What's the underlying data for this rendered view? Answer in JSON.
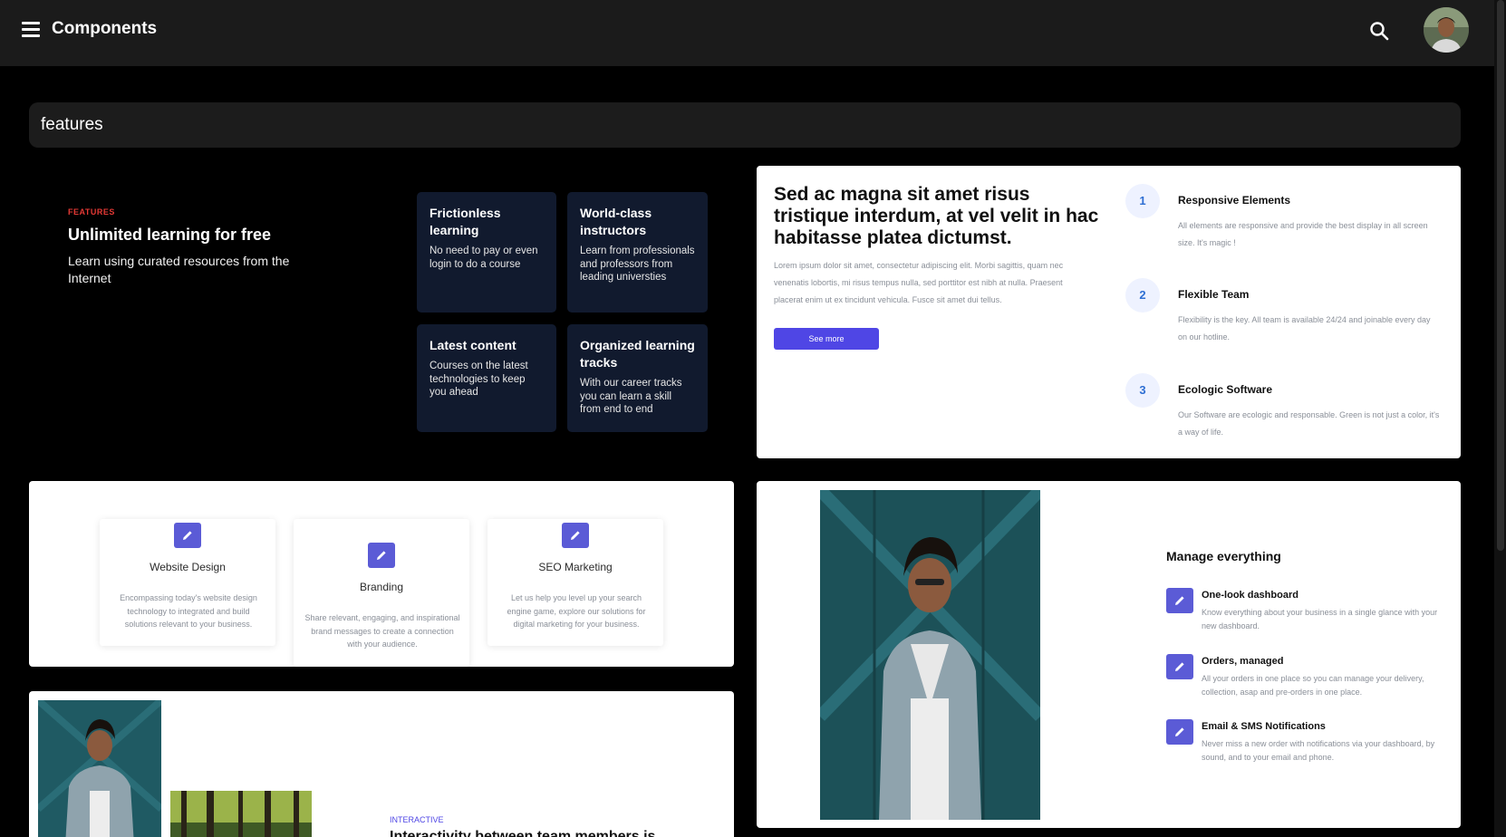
{
  "header": {
    "title": "Components"
  },
  "filter": {
    "value": "features"
  },
  "features_card": {
    "eyebrow": "FEATURES",
    "title": "Unlimited learning for free",
    "subtitle": "Learn using curated resources from the Internet",
    "boxes": [
      {
        "title": "Frictionless learning",
        "text": "No need to pay or even login to do a course"
      },
      {
        "title": "World-class instructors",
        "text": "Learn from professionals and professors from leading universties"
      },
      {
        "title": "Latest content",
        "text": "Courses on the latest technologies to keep you ahead"
      },
      {
        "title": "Organized learning tracks",
        "text": "With our career tracks you can learn a skill from end to end"
      }
    ]
  },
  "steps_card": {
    "title": "Sed ac magna sit amet risus tristique interdum, at vel velit in hac habitasse platea dictumst.",
    "description": "Lorem ipsum dolor sit amet, consectetur adipiscing elit. Morbi sagittis, quam nec venenatis lobortis, mi risus tempus nulla, sed porttitor est nibh at nulla. Praesent placerat enim ut ex tincidunt vehicula. Fusce sit amet dui tellus.",
    "button_label": "See more",
    "steps": [
      {
        "num": "1",
        "title": "Responsive Elements",
        "text": "All elements are responsive and provide the best display in all screen size. It's magic !"
      },
      {
        "num": "2",
        "title": "Flexible Team",
        "text": "Flexibility is the key. All team is available 24/24 and joinable every day on our hotline."
      },
      {
        "num": "3",
        "title": "Ecologic Software",
        "text": "Our Software are ecologic and responsable. Green is not just a color, it's a way of life."
      }
    ]
  },
  "services_card": {
    "items": [
      {
        "title": "Website Design",
        "text": "Encompassing today's website design technology to integrated and build solutions relevant to your business."
      },
      {
        "title": "Branding",
        "text": "Share relevant, engaging, and inspirational brand messages to create a connection with your audience."
      },
      {
        "title": "SEO Marketing",
        "text": "Let us help you level up your search engine game, explore our solutions for digital marketing for your business."
      }
    ]
  },
  "manage_card": {
    "title": "Manage everything",
    "items": [
      {
        "title": "One-look dashboard",
        "text": "Know everything about your business in a single glance with your new dashboard."
      },
      {
        "title": "Orders, managed",
        "text": "All your orders in one place so you can manage your delivery, collection, asap and pre-orders in one place."
      },
      {
        "title": "Email & SMS Notifications",
        "text": "Never miss a new order with notifications via your dashboard, by sound, and to your email and phone."
      }
    ]
  },
  "interactive_card": {
    "eyebrow": "INTERACTIVE",
    "title": "Interactivity between team members is"
  },
  "colors": {
    "accent": "#4f46e5",
    "icon_bg": "#5b5bd6",
    "eyebrow_red": "#e53935",
    "dark_box": "#111a2e",
    "topbar": "#1b1b1b"
  }
}
